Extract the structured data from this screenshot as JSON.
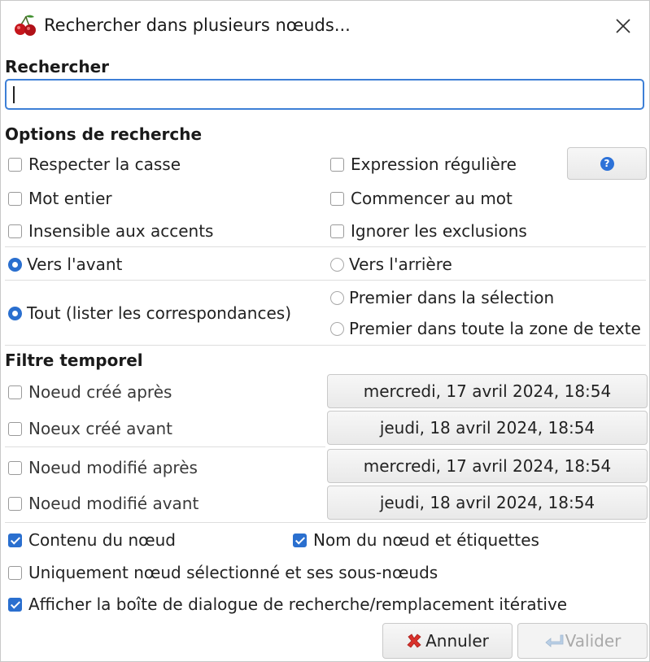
{
  "window": {
    "title": "Rechercher dans plusieurs nœuds...",
    "close_glyph": "✕",
    "icon": "cherry-icon"
  },
  "search": {
    "label": "Rechercher",
    "value": "",
    "placeholder": ""
  },
  "options": {
    "label": "Options de recherche",
    "respecter_casse": {
      "label": "Respecter la casse",
      "checked": false
    },
    "expression_reguliere": {
      "label": "Expression régulière",
      "checked": false
    },
    "help_glyph": "?",
    "mot_entier": {
      "label": "Mot entier",
      "checked": false
    },
    "commencer_au_mot": {
      "label": "Commencer au mot",
      "checked": false
    },
    "insensible_accents": {
      "label": "Insensible aux accents",
      "checked": false
    },
    "ignorer_exclusions": {
      "label": "Ignorer les exclusions",
      "checked": false
    },
    "vers_avant": {
      "label": "Vers l'avant",
      "checked": true
    },
    "vers_arriere": {
      "label": "Vers l'arrière",
      "checked": false
    },
    "tout": {
      "label": "Tout (lister les correspondances)",
      "checked": true
    },
    "premier_selection": {
      "label": "Premier dans la sélection",
      "checked": false
    },
    "premier_zone": {
      "label": "Premier dans toute la zone de texte",
      "checked": false
    }
  },
  "time_filter": {
    "label": "Filtre temporel",
    "cree_apres": {
      "label": "Noeud créé après",
      "checked": false,
      "date": "mercredi, 17 avril 2024, 18:54"
    },
    "cree_avant": {
      "label": "Noeux créé avant",
      "checked": false,
      "date": "jeudi, 18 avril 2024, 18:54"
    },
    "modifie_apres": {
      "label": "Noeud modifié après",
      "checked": false,
      "date": "mercredi, 17 avril 2024, 18:54"
    },
    "modifie_avant": {
      "label": "Noeud modifié avant",
      "checked": false,
      "date": "jeudi, 18 avril 2024, 18:54"
    }
  },
  "scope": {
    "contenu_noeud": {
      "label": "Contenu du nœud",
      "checked": true
    },
    "nom_etiquettes": {
      "label": "Nom du nœud et étiquettes",
      "checked": true
    },
    "uniquement_selection": {
      "label": "Uniquement nœud sélectionné et ses sous-nœuds",
      "checked": false
    },
    "afficher_iterative": {
      "label": "Afficher la boîte de dialogue de recherche/remplacement itérative",
      "checked": true
    }
  },
  "buttons": {
    "annuler": "Annuler",
    "valider": "Valider"
  },
  "colors": {
    "accent": "#2a6fcf",
    "cancel_icon": "#d9312b",
    "disabled_text": "#a9a9a9"
  }
}
